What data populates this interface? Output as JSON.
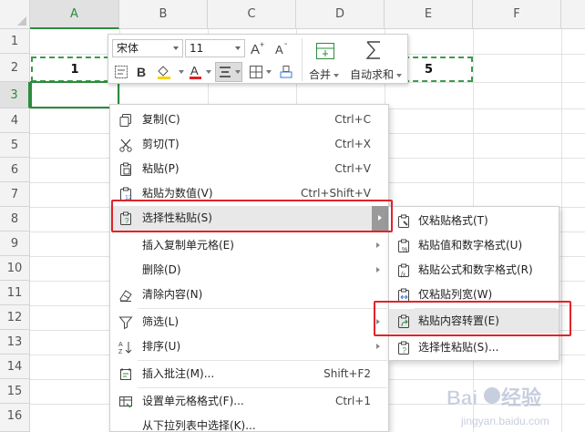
{
  "sheet": {
    "columns": [
      "A",
      "B",
      "C",
      "D",
      "E",
      "F"
    ],
    "rows": [
      "1",
      "2",
      "3",
      "4",
      "5",
      "6",
      "7",
      "8",
      "9",
      "10",
      "11",
      "12",
      "13",
      "14",
      "15",
      "16"
    ],
    "active_column": "A",
    "active_row": "3",
    "cells": {
      "A2": "1",
      "E2": "5"
    }
  },
  "mini_toolbar": {
    "font_name": "宋体",
    "font_size": "11",
    "merge_label": "合并",
    "autosum_label": "自动求和"
  },
  "context_menu": {
    "items": [
      {
        "label": "复制(C)",
        "shortcut": "Ctrl+C",
        "icon": "copy-icon"
      },
      {
        "label": "剪切(T)",
        "shortcut": "Ctrl+X",
        "icon": "cut-icon"
      },
      {
        "label": "粘贴(P)",
        "shortcut": "Ctrl+V",
        "icon": "paste-icon"
      },
      {
        "label": "粘贴为数值(V)",
        "shortcut": "Ctrl+Shift+V",
        "icon": "paste-values-icon"
      },
      {
        "label": "选择性粘贴(S)",
        "shortcut": "",
        "icon": "paste-special-icon",
        "submenu": true,
        "highlighted": true
      },
      {
        "label": "插入复制单元格(E)",
        "shortcut": "",
        "submenu": true
      },
      {
        "label": "删除(D)",
        "shortcut": "",
        "submenu": true
      },
      {
        "label": "清除内容(N)",
        "shortcut": "",
        "icon": "eraser-icon"
      },
      {
        "label": "筛选(L)",
        "shortcut": "",
        "icon": "filter-icon",
        "submenu": true
      },
      {
        "label": "排序(U)",
        "shortcut": "",
        "icon": "sort-az-icon",
        "submenu": true
      },
      {
        "label": "插入批注(M)...",
        "shortcut": "Shift+F2",
        "icon": "comment-icon"
      },
      {
        "label": "设置单元格格式(F)...",
        "shortcut": "Ctrl+1",
        "icon": "format-cells-icon"
      },
      {
        "label": "从下拉列表中选择(K)...",
        "shortcut": ""
      }
    ]
  },
  "paste_submenu": {
    "items": [
      {
        "label": "仅粘贴格式(T)",
        "icon": "paste-format-icon"
      },
      {
        "label": "粘贴值和数字格式(U)",
        "icon": "paste-value-number-icon"
      },
      {
        "label": "粘贴公式和数字格式(R)",
        "icon": "paste-formula-number-icon"
      },
      {
        "label": "仅粘贴列宽(W)",
        "icon": "paste-column-width-icon"
      },
      {
        "label": "粘贴内容转置(E)",
        "icon": "paste-transpose-icon",
        "highlighted": true
      },
      {
        "label": "选择性粘贴(S)...",
        "icon": "paste-special-dialog-icon"
      }
    ]
  },
  "colors": {
    "selection_green": "#2e8b3e",
    "annotation_red": "#e0232a",
    "font_color_red": "#e02020",
    "fill_color_yellow": "#f5d400"
  },
  "watermark": {
    "brand": "Baidu",
    "text": "经验",
    "url": "jingyan.baidu.com"
  }
}
